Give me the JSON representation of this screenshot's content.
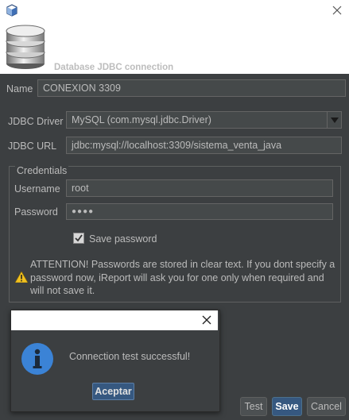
{
  "header": {
    "title": "Database JDBC connection"
  },
  "form": {
    "name_label": "Name",
    "name_value": "CONEXION 3309",
    "driver_label": "JDBC Driver",
    "driver_value": "MySQL (com.mysql.jdbc.Driver)",
    "url_label": "JDBC URL",
    "url_value": "jdbc:mysql://localhost:3309/sistema_venta_java",
    "credentials_title": "Credentials",
    "username_label": "Username",
    "username_value": "root",
    "password_label": "Password",
    "password_value": "●●●●",
    "save_password_label": "Save password",
    "save_password_checked": true,
    "warning_text": "ATTENTION! Passwords are stored in clear text. If you dont specify a password now, iReport will ask you for one only when required and will not save it."
  },
  "buttons": {
    "test": "Test",
    "save": "Save",
    "cancel": "Cancel"
  },
  "dialog": {
    "message": "Connection test successful!",
    "ok_label": "Aceptar"
  },
  "icons": {
    "app": "app-cube-icon",
    "close": "close-icon",
    "database": "database-icon",
    "combo": "chevron-down-icon",
    "checkbox": "checkmark-icon",
    "warning": "warning-icon",
    "info": "info-icon"
  },
  "colors": {
    "background": "#3c3f41",
    "field": "#45494a",
    "default_button": "#365880",
    "info_icon": "#3b83d6",
    "warning_icon": "#f0c020"
  }
}
